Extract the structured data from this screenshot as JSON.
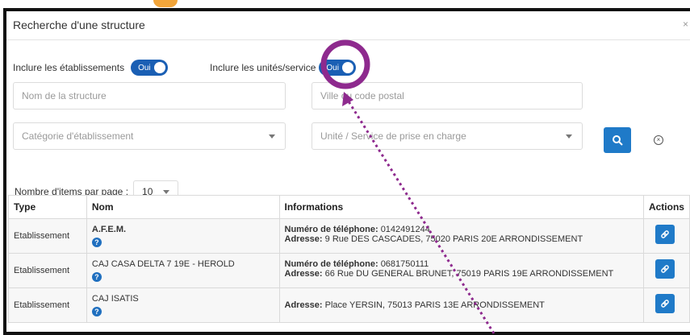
{
  "dialog": {
    "title": "Recherche d'une structure",
    "close_glyph": "×"
  },
  "toggles": {
    "etablissements_label": "Inclure les établissements",
    "etablissements_value": "Oui",
    "unites_label": "Inclure les unités/service",
    "unites_value": "Oui"
  },
  "search": {
    "nom_placeholder": "Nom de la structure",
    "ville_placeholder": "Ville ou code postal",
    "categorie_placeholder": "Catégorie d'établissement",
    "unite_placeholder": "Unité / Service de prise en charge"
  },
  "pagination": {
    "label": "Nombre d'items par page :",
    "value": "10"
  },
  "table": {
    "headers": {
      "type": "Type",
      "nom": "Nom",
      "informations": "Informations",
      "actions": "Actions"
    },
    "rows": [
      {
        "type": "Etablissement",
        "nom": "A.F.E.M.",
        "phone_label": "Numéro de téléphone:",
        "phone": "0142491244",
        "address_label": "Adresse:",
        "address": "9 Rue DES CASCADES, 75020 PARIS 20E ARRONDISSEMENT"
      },
      {
        "type": "Etablissement",
        "nom": "CAJ CASA DELTA 7 19E - HEROLD",
        "phone_label": "Numéro de téléphone:",
        "phone": "0681750111",
        "address_label": "Adresse:",
        "address": "66 Rue DU GENERAL BRUNET, 75019 PARIS 19E ARRONDISSEMENT"
      },
      {
        "type": "Etablissement",
        "nom": "CAJ ISATIS",
        "address_label": "Adresse:",
        "address": "Place YERSIN, 75013 PARIS 13E ARRONDISSEMENT"
      }
    ]
  },
  "icons": {
    "search": "search-icon",
    "reset": "circle-x-icon",
    "link": "link-icon",
    "info": "info-icon"
  },
  "colors": {
    "primary": "#1f7ac8",
    "toggle": "#1a5fb4",
    "highlight_circle": "#8e2a8e",
    "arrow": "#8e2a8e",
    "accent_orange": "#f2a53a"
  }
}
